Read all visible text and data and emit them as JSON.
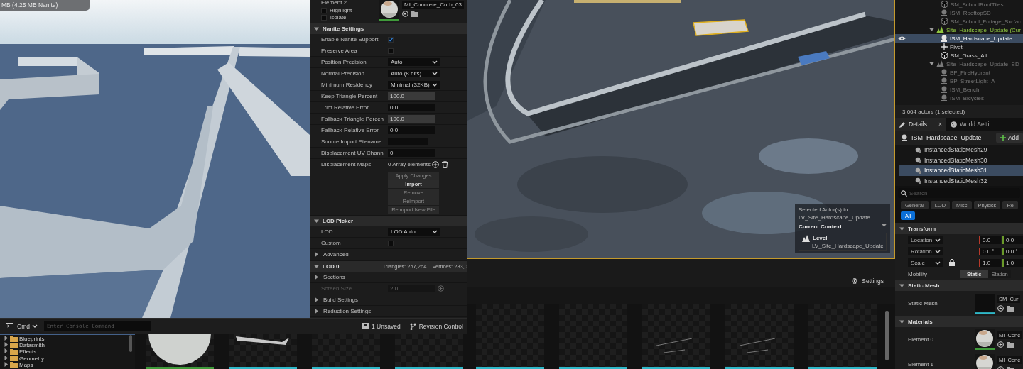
{
  "left_viewport": {
    "stats": "MB (4.25 MB Nanite)"
  },
  "mesh_panel": {
    "slot": {
      "label": "Element 2",
      "highlight": {
        "label": "Highlight",
        "checked": false
      },
      "isolate": {
        "label": "Isolate",
        "checked": false
      },
      "material": "MI_Concrete_Curb_03"
    },
    "sections": [
      {
        "title": "Nanite Settings",
        "expanded": true,
        "rows": [
          {
            "kind": "checkbox",
            "label": "Enable Nanite Support",
            "checked": true
          },
          {
            "kind": "checkbox",
            "label": "Preserve Area",
            "checked": false
          },
          {
            "kind": "dropdown",
            "label": "Position Precision",
            "value": "Auto"
          },
          {
            "kind": "dropdown",
            "label": "Normal Precision",
            "value": "Auto (8 bits)"
          },
          {
            "kind": "dropdown",
            "label": "Minimum Residency",
            "value": "Minimal (32KB)"
          },
          {
            "kind": "slider",
            "label": "Keep Triangle Percent",
            "value": "100.0"
          },
          {
            "kind": "number",
            "label": "Trim Relative Error",
            "value": "0.0",
            "disabled": false
          },
          {
            "kind": "slider",
            "label": "Fallback Triangle Percen",
            "value": "100.0"
          },
          {
            "kind": "number",
            "label": "Fallback Relative Error",
            "value": "0.0",
            "disabled": false
          },
          {
            "kind": "file",
            "label": "Source Import Filename",
            "browse": "..."
          },
          {
            "kind": "number",
            "label": "Displacement UV Chann",
            "value": "0",
            "disabled": false
          },
          {
            "kind": "array",
            "label": "Displacement Maps",
            "value": "0 Array elements"
          },
          {
            "kind": "action",
            "label": "Apply Changes",
            "disabled": true
          },
          {
            "kind": "action",
            "label": "Import",
            "disabled": false
          },
          {
            "kind": "action",
            "label": "Remove",
            "disabled": true
          },
          {
            "kind": "action",
            "label": "Reimport",
            "disabled": true
          },
          {
            "kind": "action",
            "label": "Reimport New File",
            "disabled": true
          }
        ]
      },
      {
        "title": "LOD Picker",
        "expanded": true,
        "rows": [
          {
            "kind": "dropdown",
            "label": "LOD",
            "value": "LOD Auto"
          },
          {
            "kind": "checkbox",
            "label": "Custom",
            "checked": false
          },
          {
            "kind": "group",
            "label": "Advanced",
            "expanded": false
          }
        ]
      },
      {
        "title": "LOD 0",
        "expanded": true,
        "info": [
          "Triangles: 257,264",
          "Vertices: 283,0"
        ],
        "rows": [
          {
            "kind": "group",
            "label": "Sections",
            "expanded": false
          },
          {
            "kind": "number",
            "label": "Screen Size",
            "value": "2.0",
            "disabled": true
          },
          {
            "kind": "group",
            "label": "Build Settings",
            "expanded": false
          },
          {
            "kind": "group",
            "label": "Reduction Settings",
            "expanded": false
          }
        ]
      }
    ]
  },
  "console": {
    "label": "Cmd",
    "placeholder": "Enter Console Command",
    "unsaved": "1 Unsaved",
    "revision": "Revision Control"
  },
  "folders": [
    {
      "label": "Blueprints",
      "expanded": false
    },
    {
      "label": "Datasmith",
      "expanded": false
    },
    {
      "label": "Effects",
      "expanded": false
    },
    {
      "label": "Geometry",
      "expanded": false
    },
    {
      "label": "Maps",
      "expanded": false
    }
  ],
  "thumbnails_left": [
    {
      "kind": "sphere",
      "color": "#3f9a3a"
    },
    {
      "kind": "curb",
      "color": "#2fb8c8"
    },
    {
      "kind": "blank",
      "color": "#2fb8c8"
    },
    {
      "kind": "blank",
      "color": "#2fb8c8"
    }
  ],
  "viewport": {
    "context": {
      "caption": "Selected Actor(s) in",
      "level_name": "LV_Site_Hardscape_Update",
      "title": "Current Context",
      "level_label": "Level",
      "level_value": "LV_Site_Hardscape_Update"
    },
    "settings": "Settings"
  },
  "thumbnails_right": [
    {
      "kind": "blank",
      "color": "#2fb8c8"
    },
    {
      "kind": "blank",
      "color": "#2fb8c8"
    },
    {
      "kind": "lines",
      "color": "#2fb8c8"
    },
    {
      "kind": "lines",
      "color": "#2fb8c8"
    },
    {
      "kind": "blank",
      "color": "#2fb8c8"
    }
  ],
  "outliner": {
    "items": [
      {
        "kind": "offscreen",
        "children": [
          {
            "kind": "static",
            "label": "SM_SchoolRoofTiles",
            "dimmed": true,
            "selected": false
          },
          {
            "kind": "mesh",
            "label": "ISM_RooftopSD",
            "dimmed": true,
            "selected": false
          },
          {
            "kind": "static",
            "label": "SM_School_Foliage_Surfac",
            "dimmed": true,
            "selected": false
          }
        ]
      },
      {
        "kind": "folder",
        "label": "Site_Hardscape_Update (Cur",
        "current": true,
        "expanded": true,
        "dimmed": false,
        "selected": false,
        "children": [
          {
            "kind": "mesh",
            "label": "ISM_Hardscape_Update",
            "dimmed": false,
            "selected": true
          },
          {
            "kind": "pivot",
            "label": "Pivot",
            "dimmed": false,
            "selected": false
          },
          {
            "kind": "static",
            "label": "SM_Grass_All",
            "dimmed": false,
            "selected": false
          }
        ]
      },
      {
        "kind": "folder",
        "label": "Site_Hardscape_Update_SD",
        "current": false,
        "expanded": true,
        "dimmed": true,
        "selected": false,
        "children": [
          {
            "kind": "mesh",
            "label": "BP_FireHydrant",
            "dimmed": true,
            "selected": false
          },
          {
            "kind": "mesh",
            "label": "BP_StreetLight_A",
            "dimmed": true,
            "selected": false
          },
          {
            "kind": "mesh",
            "label": "ISM_Bench",
            "dimmed": true,
            "selected": false
          },
          {
            "kind": "mesh",
            "label": "ISM_Bicycles",
            "dimmed": true,
            "selected": false
          }
        ]
      }
    ],
    "count": "3,664 actors (1 selected)"
  },
  "details": {
    "tabs": [
      {
        "label": "Details",
        "selected": true,
        "close": "×"
      },
      {
        "label": "World Setti…",
        "selected": false
      }
    ],
    "actor": "ISM_Hardscape_Update",
    "add": "Add",
    "components": [
      {
        "label": "InstancedStaticMesh29",
        "selected": false
      },
      {
        "label": "InstancedStaticMesh30",
        "selected": false
      },
      {
        "label": "InstancedStaticMesh31",
        "selected": true
      },
      {
        "label": "InstancedStaticMesh32",
        "selected": false
      }
    ],
    "search": {
      "placeholder": "Search"
    },
    "filters": [
      {
        "label": "General",
        "selected": false
      },
      {
        "label": "LOD",
        "selected": false
      },
      {
        "label": "Misc",
        "selected": false
      },
      {
        "label": "Physics",
        "selected": false
      },
      {
        "label": "Re",
        "selected": false
      },
      {
        "label": "All",
        "selected": true
      }
    ],
    "transform": {
      "title": "Transform",
      "rows": [
        {
          "label": "Location",
          "values": [
            "0.0",
            "0.0"
          ],
          "lock": false
        },
        {
          "label": "Rotation",
          "values": [
            "0.0 °",
            "0.0 °"
          ],
          "lock": false
        },
        {
          "label": "Scale",
          "values": [
            "1.0",
            "1.0"
          ],
          "lock": true
        }
      ],
      "mobility": {
        "label": "Mobility",
        "options": [
          {
            "label": "Static",
            "selected": true
          },
          {
            "label": "Station",
            "selected": false
          }
        ]
      }
    },
    "static_mesh": {
      "title": "Static Mesh",
      "label": "Static Mesh",
      "asset": "SM_Cur"
    },
    "materials": {
      "title": "Materials",
      "elements": [
        {
          "label": "Element 0",
          "asset": "MI_Conc"
        },
        {
          "label": "Element 1",
          "asset": "MI_Conc"
        }
      ]
    }
  }
}
